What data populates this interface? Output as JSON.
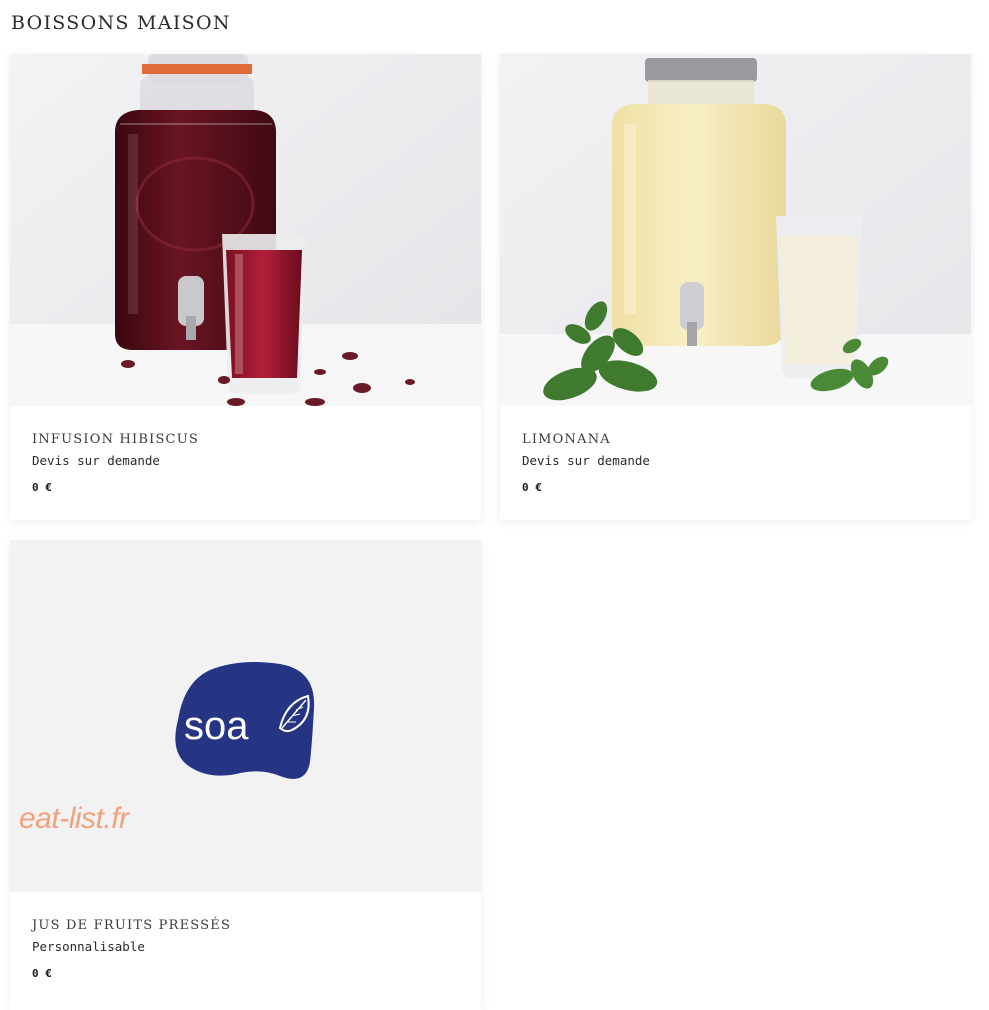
{
  "section": {
    "title": "BOISSONS MAISON"
  },
  "products": [
    {
      "name": "INFUSION HIBISCUS",
      "subtitle": "Devis sur demande",
      "price": "0 €"
    },
    {
      "name": "LIMONANA",
      "subtitle": "Devis sur demande",
      "price": "0 €"
    },
    {
      "name": "JUS DE FRUITS PRESSÉS",
      "subtitle": "Personnalisable",
      "price": "0 €",
      "placeholder": {
        "logo_text": "soa",
        "watermark": "eat-list.fr"
      }
    }
  ],
  "colors": {
    "hibiscus": "#5e0f1c",
    "lemonade": "#f4e9b8",
    "mint": "#3f7a2e",
    "logo_blue": "#253583",
    "watermark": "#f0a27d",
    "placeholder_bg": "#f2f2f2"
  }
}
